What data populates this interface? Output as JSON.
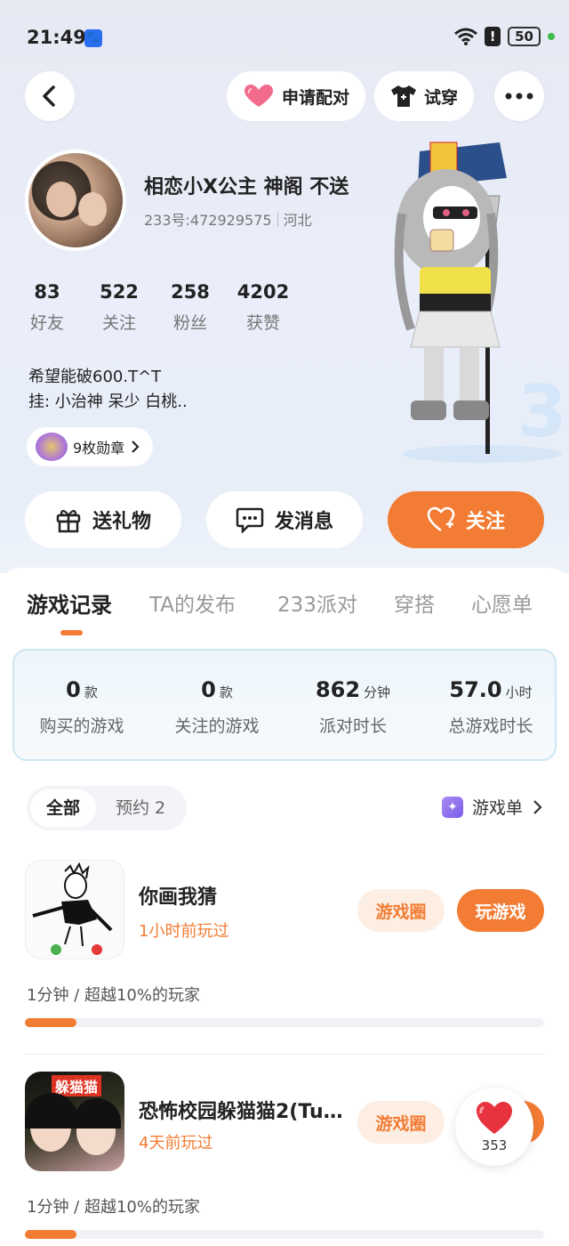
{
  "status_bar": {
    "time": "21:49",
    "battery": "50"
  },
  "nav": {
    "apply_pair": "申请配对",
    "try_on": "试穿"
  },
  "profile": {
    "nickname": "相恋小X公主 神阁 不送",
    "id_label": "233号:472929575",
    "region": "河北",
    "bio_line1": "希望能破600.T^T",
    "bio_line2": "挂: 小治神   呆少    白桃..",
    "medals": "9枚勋章"
  },
  "stats": [
    {
      "value": "83",
      "label": "好友"
    },
    {
      "value": "522",
      "label": "关注"
    },
    {
      "value": "258",
      "label": "粉丝"
    },
    {
      "value": "4202",
      "label": "获赞"
    }
  ],
  "actions": {
    "gift": "送礼物",
    "message": "发消息",
    "follow": "关注"
  },
  "tabs": [
    "游戏记录",
    "TA的发布",
    "233派对",
    "穿搭",
    "心愿单"
  ],
  "summary": [
    {
      "value": "0",
      "unit": "款",
      "label": "购买的游戏"
    },
    {
      "value": "0",
      "unit": "款",
      "label": "关注的游戏"
    },
    {
      "value": "862",
      "unit": "分钟",
      "label": "派对时长"
    },
    {
      "value": "57.0",
      "unit": "小时",
      "label": "总游戏时长"
    }
  ],
  "filter": {
    "all": "全部",
    "reserved": "预约 2",
    "game_list": "游戏单"
  },
  "games": [
    {
      "title": "你画我猜",
      "last_played": "1小时前玩过",
      "circle": "游戏圈",
      "play": "玩游戏",
      "desc": "1分钟 / 超越10%的玩家",
      "progress": 0.1
    },
    {
      "title": "恐怖校园躲猫猫2(Tu…",
      "last_played": "4天前玩过",
      "circle": "游戏圈",
      "play": "",
      "desc": "1分钟 / 超越10%的玩家",
      "progress": 0.1,
      "thumb_text": "躲猫猫"
    }
  ],
  "like_count": "353",
  "colors": {
    "accent": "#f27c33",
    "accent_light": "#fdeee3"
  }
}
